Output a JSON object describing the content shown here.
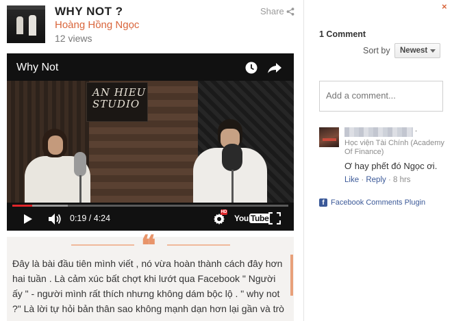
{
  "video": {
    "title": "WHY NOT ?",
    "author": "Hoàng Hồng Ngọc",
    "views": "12 views",
    "share_label": "Share"
  },
  "player": {
    "title": "Why Not",
    "time": "0:19 / 4:24",
    "progress_fraction": 0.072,
    "buffered_fraction": 0.2,
    "hd_label": "HD",
    "brand_left": "You",
    "brand_right": "Tube",
    "studio_logo": "AN HIEU STUDIO"
  },
  "article": {
    "quote_glyph": "❝",
    "text": "Đây là bài đầu tiên mình viết , nó vừa hoàn thành cách đây hơn hai tuần . Là cảm xúc bất chợt khi lướt qua Facebook \" Người ấy \" - người mình rất thích nhưng không dám bộc lộ . \" why not ?\" Là lời tự hỏi bản thân sao không mạnh dạn hơn lại gần và trò"
  },
  "comments": {
    "close_glyph": "×",
    "count_label": "1 Comment",
    "sort_label": "Sort by",
    "sort_value": "Newest",
    "input_placeholder": "Add a comment...",
    "items": [
      {
        "name_dot": ".",
        "school": "Học viện Tài Chính (Academy Of Finance)",
        "text": "Ơ hay phết đó Ngọc ơi.",
        "like": "Like",
        "reply": "Reply",
        "age": "8 hrs"
      }
    ],
    "plugin_label": "Facebook Comments Plugin",
    "plugin_icon_glyph": "f"
  },
  "colors": {
    "accent": "#d9653b",
    "fb_blue": "#3b5998",
    "progress_red": "#e0262a"
  }
}
